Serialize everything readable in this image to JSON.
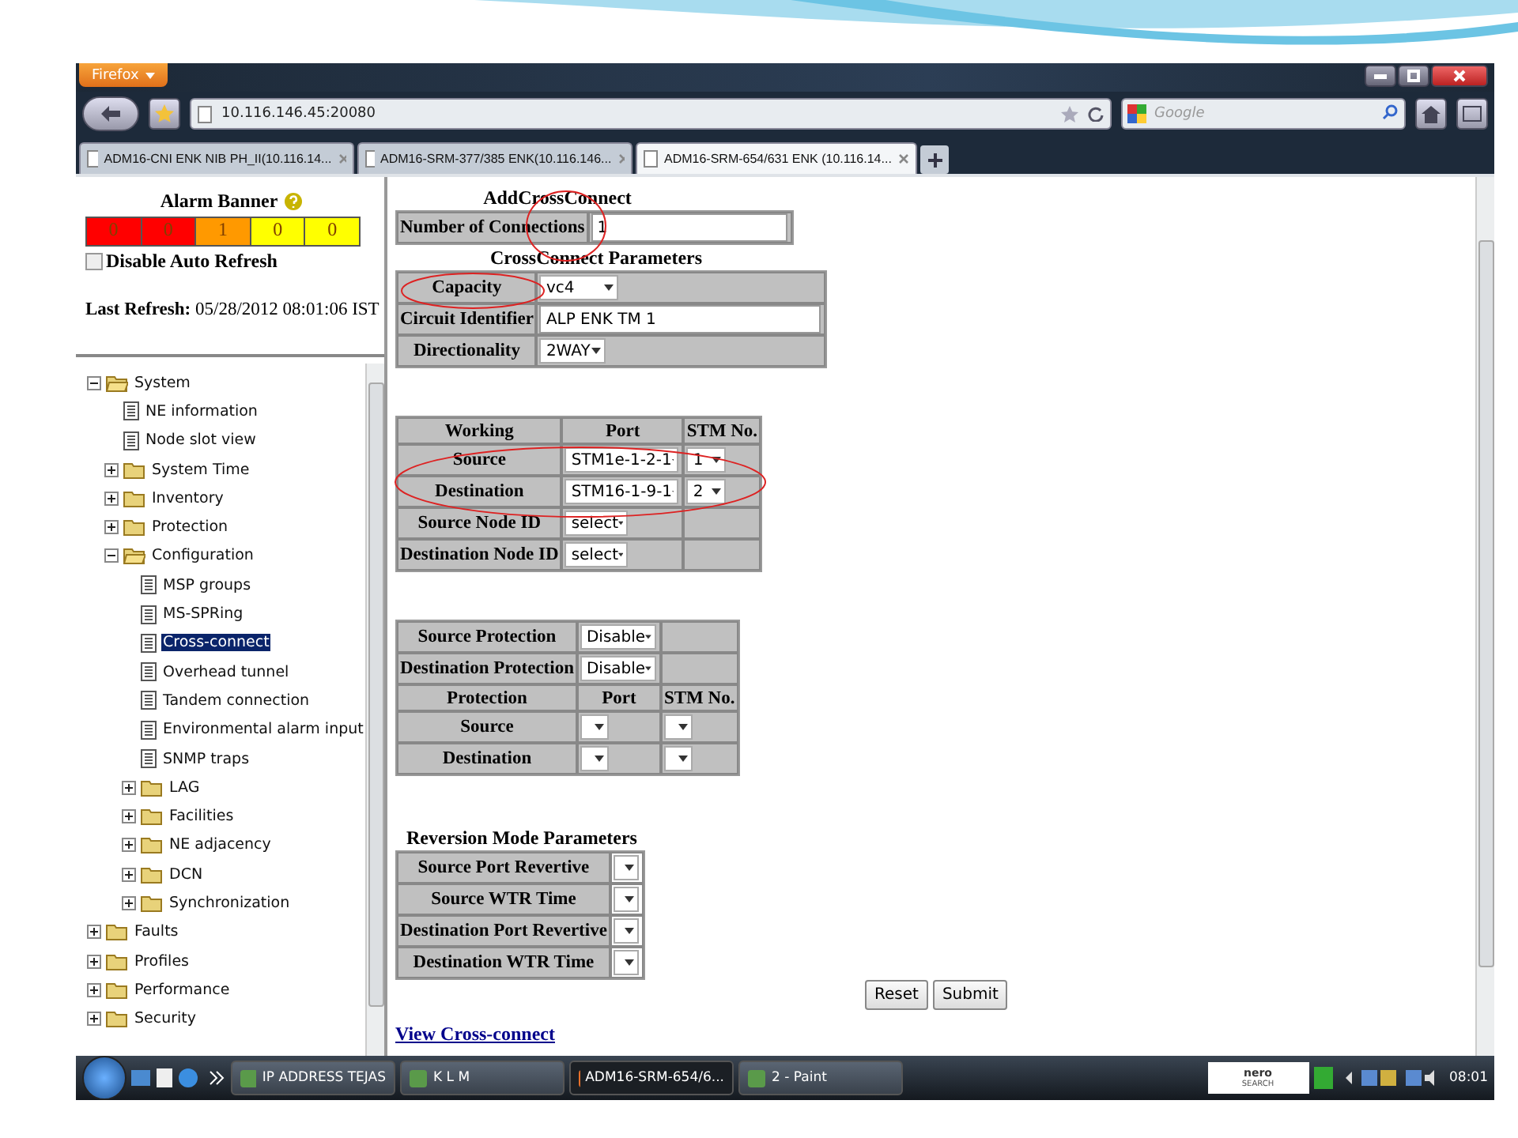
{
  "browser": {
    "menu_button": "Firefox",
    "address": "10.116.146.45:20080",
    "search_placeholder": "Google",
    "tabs": [
      {
        "label": "ADM16-CNI ENK NIB PH_II(10.116.14...",
        "selected": false
      },
      {
        "label": "ADM16-SRM-377/385 ENK(10.116.146...",
        "selected": false
      },
      {
        "label": "ADM16-SRM-654/631 ENK (10.116.14...",
        "selected": true
      }
    ]
  },
  "alarm_banner": {
    "title": "Alarm Banner",
    "counts": [
      {
        "value": "0",
        "color": "#ff0000"
      },
      {
        "value": "0",
        "color": "#ff0000"
      },
      {
        "value": "1",
        "color": "#ff9900"
      },
      {
        "value": "0",
        "color": "#ffff00"
      },
      {
        "value": "0",
        "color": "#ffff00"
      }
    ],
    "auto_refresh": {
      "label": "Disable Auto Refresh",
      "checked": false
    },
    "last_refresh_label": "Last Refresh:",
    "last_refresh_value": "05/28/2012 08:01:06 IST"
  },
  "tree": [
    {
      "label": "System",
      "kind": "folder",
      "expanded": true,
      "children": [
        {
          "label": "NE information",
          "kind": "page",
          "selected": false
        },
        {
          "label": "Node slot view",
          "kind": "page",
          "selected": false
        },
        {
          "label": "System Time",
          "kind": "folder",
          "expanded": false
        },
        {
          "label": "Inventory",
          "kind": "folder",
          "expanded": false
        },
        {
          "label": "Protection",
          "kind": "folder",
          "expanded": false
        },
        {
          "label": "Configuration",
          "kind": "folder",
          "expanded": true,
          "children": [
            {
              "label": "MSP groups",
              "kind": "page",
              "selected": false
            },
            {
              "label": "MS-SPRing",
              "kind": "page",
              "selected": false
            },
            {
              "label": "Cross-connect",
              "kind": "page",
              "selected": true
            },
            {
              "label": "Overhead tunnel",
              "kind": "page",
              "selected": false
            },
            {
              "label": "Tandem connection",
              "kind": "page",
              "selected": false
            },
            {
              "label": "Environmental alarm input",
              "kind": "page",
              "selected": false
            },
            {
              "label": "SNMP traps",
              "kind": "page",
              "selected": false
            },
            {
              "label": "LAG",
              "kind": "folder",
              "expanded": false
            },
            {
              "label": "Facilities",
              "kind": "folder",
              "expanded": false
            },
            {
              "label": "NE adjacency",
              "kind": "folder",
              "expanded": false
            },
            {
              "label": "DCN",
              "kind": "folder",
              "expanded": false
            },
            {
              "label": "Synchronization",
              "kind": "folder",
              "expanded": false
            }
          ]
        }
      ]
    },
    {
      "label": "Faults",
      "kind": "folder",
      "expanded": false
    },
    {
      "label": "Profiles",
      "kind": "folder",
      "expanded": false
    },
    {
      "label": "Performance",
      "kind": "folder",
      "expanded": false
    },
    {
      "label": "Security",
      "kind": "folder",
      "expanded": false
    }
  ],
  "form": {
    "title": "AddCrossConnect",
    "connections": {
      "label": "Number of Connections",
      "value": "1"
    },
    "parameters_title": "CrossConnect Parameters",
    "parameters": [
      {
        "label": "Capacity",
        "kind": "select",
        "value": "vc4"
      },
      {
        "label": "Circuit Identifier",
        "kind": "text",
        "value": "ALP ENK TM 1"
      },
      {
        "label": "Directionality",
        "kind": "select",
        "value": "2WAY"
      }
    ],
    "working": {
      "columns": [
        "Working",
        "Port",
        "STM No."
      ],
      "rows": [
        {
          "label": "Source",
          "port": "STM1e-1-2-1",
          "stm": "1"
        },
        {
          "label": "Destination",
          "port": "STM16-1-9-1",
          "stm": "2"
        }
      ],
      "node_ids": [
        {
          "label": "Source Node ID",
          "value": "select"
        },
        {
          "label": "Destination Node ID",
          "value": "select"
        }
      ]
    },
    "protection": {
      "modes": [
        {
          "label": "Source Protection",
          "value": "Disable"
        },
        {
          "label": "Destination Protection",
          "value": "Disable"
        }
      ],
      "columns": [
        "Protection",
        "Port",
        "STM No."
      ],
      "rows": [
        {
          "label": "Source"
        },
        {
          "label": "Destination"
        }
      ]
    },
    "reversion_title": "Reversion Mode Parameters",
    "reversion": [
      {
        "label": "Source Port Revertive"
      },
      {
        "label": "Source WTR Time"
      },
      {
        "label": "Destination Port Revertive"
      },
      {
        "label": "Destination WTR Time"
      }
    ],
    "buttons": [
      "Reset",
      "Submit"
    ],
    "link": "View Cross-connect"
  },
  "taskbar": {
    "items": [
      {
        "label": "IP ADDRESS TEJAS",
        "selected": false
      },
      {
        "label": "K L M",
        "selected": false
      },
      {
        "label": "ADM16-SRM-654/6...",
        "selected": true
      },
      {
        "label": "2 - Paint",
        "selected": false
      }
    ],
    "tray_logo": [
      "nero",
      "SEARCH"
    ],
    "clock": "08:01"
  }
}
